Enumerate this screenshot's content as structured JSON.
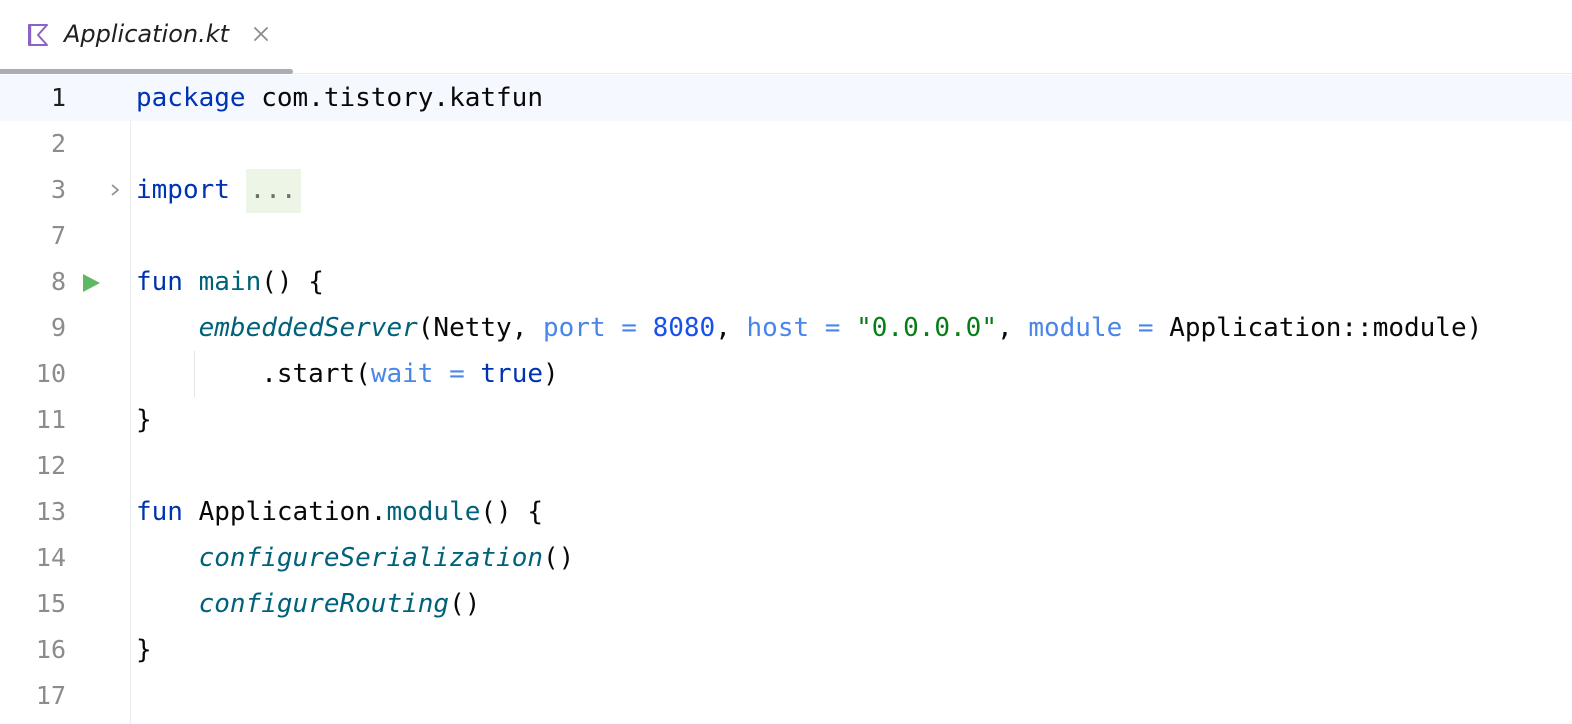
{
  "tab": {
    "file_name": "Application.kt",
    "icon": "kotlin-file-icon",
    "close_icon": "close-icon"
  },
  "editor": {
    "lines": [
      {
        "number": "1",
        "tokens": [
          {
            "t": "package",
            "c": "kw"
          },
          {
            "t": " com.tistory.katfun"
          }
        ]
      },
      {
        "number": "2",
        "tokens": []
      },
      {
        "number": "3",
        "tokens": [
          {
            "t": "import",
            "c": "kw"
          },
          {
            "t": " "
          },
          {
            "t": "...",
            "c": "fold-ph"
          }
        ]
      },
      {
        "number": "7",
        "tokens": []
      },
      {
        "number": "8",
        "tokens": [
          {
            "t": "fun",
            "c": "kw"
          },
          {
            "t": " "
          },
          {
            "t": "main",
            "c": "fn"
          },
          {
            "t": "() {"
          }
        ]
      },
      {
        "number": "9",
        "tokens": [
          {
            "t": "    "
          },
          {
            "t": "embeddedServer",
            "c": "fncall"
          },
          {
            "t": "(Netty, "
          },
          {
            "t": "port =",
            "c": "named"
          },
          {
            "t": " "
          },
          {
            "t": "8080",
            "c": "num"
          },
          {
            "t": ", "
          },
          {
            "t": "host =",
            "c": "named"
          },
          {
            "t": " "
          },
          {
            "t": "\"0.0.0.0\"",
            "c": "str"
          },
          {
            "t": ", "
          },
          {
            "t": "module =",
            "c": "named"
          },
          {
            "t": " Application::module)"
          }
        ]
      },
      {
        "number": "10",
        "tokens": [
          {
            "t": "        .start("
          },
          {
            "t": "wait =",
            "c": "named"
          },
          {
            "t": " "
          },
          {
            "t": "true",
            "c": "kw"
          },
          {
            "t": ")"
          }
        ]
      },
      {
        "number": "11",
        "tokens": [
          {
            "t": "}"
          }
        ]
      },
      {
        "number": "12",
        "tokens": []
      },
      {
        "number": "13",
        "tokens": [
          {
            "t": "fun",
            "c": "kw"
          },
          {
            "t": " Application."
          },
          {
            "t": "module",
            "c": "fn"
          },
          {
            "t": "() {"
          }
        ]
      },
      {
        "number": "14",
        "tokens": [
          {
            "t": "    "
          },
          {
            "t": "configureSerialization",
            "c": "fncall"
          },
          {
            "t": "()"
          }
        ]
      },
      {
        "number": "15",
        "tokens": [
          {
            "t": "    "
          },
          {
            "t": "configureRouting",
            "c": "fncall"
          },
          {
            "t": "()"
          }
        ]
      },
      {
        "number": "16",
        "tokens": [
          {
            "t": "}"
          }
        ]
      },
      {
        "number": "17",
        "tokens": []
      }
    ],
    "current_line": "1",
    "run_gutter_line": "8",
    "fold_gutter_line": "3",
    "colors": {
      "keyword": "#0033b3",
      "function": "#00627a",
      "named_argument": "#4a86e8",
      "number": "#1750eb",
      "string": "#067d17",
      "run_icon": "#5fb865",
      "current_line_bg": "#f5f8fe"
    }
  }
}
